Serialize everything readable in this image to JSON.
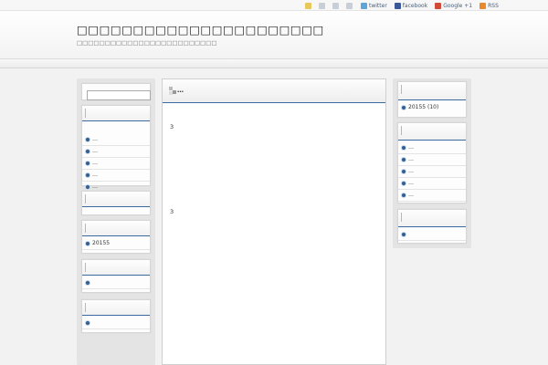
{
  "topbar": {
    "twitter_label": "twitter",
    "facebook_label": "facebook",
    "google_label": "Google +1",
    "rss_label": "RSS"
  },
  "header": {
    "title": "□□□□□□□□□□□□□□□□□□□□□□",
    "description": "□□□□□□□□□□□□□□□□□□□□□□□□□"
  },
  "left_sidebar": {
    "recent_items": [
      "…",
      "…",
      "…",
      "…",
      "…"
    ],
    "archive_item": "20155",
    "link_item": "",
    "meta_item": ""
  },
  "main": {
    "title": "…",
    "text1": "3",
    "text2": "3"
  },
  "right_sidebar": {
    "archive_item": "20155 (10)",
    "recent_items": [
      "…",
      "…",
      "…",
      "…",
      "…"
    ],
    "last_item": ""
  }
}
